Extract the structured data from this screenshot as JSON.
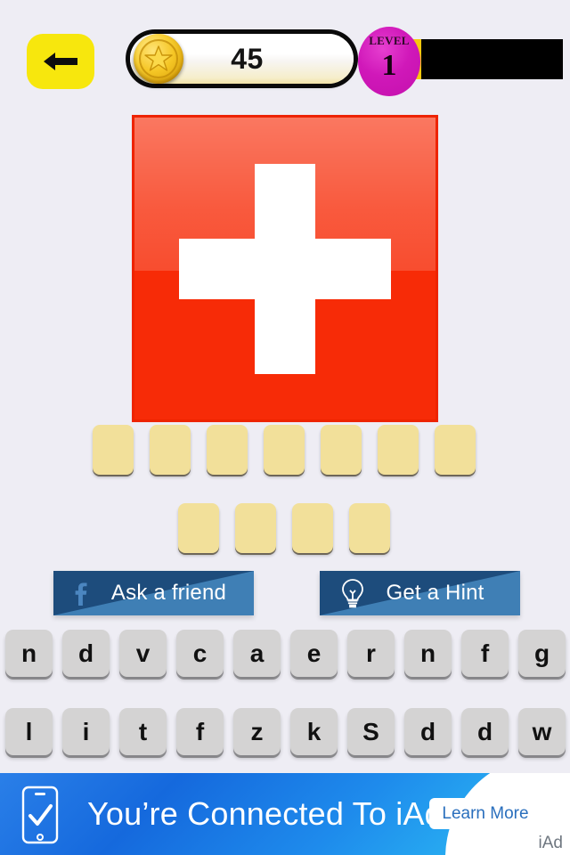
{
  "topbar": {
    "back_icon": "arrow-left-icon",
    "coin_icon": "gold-coin-star-icon",
    "coin_count": "45",
    "level_word": "LEVEL",
    "level_number": "1",
    "progress_percent": 17,
    "progress_fill_color": "#f7c80c",
    "progress_track_color": "#000000",
    "badge_color": "#d018b9",
    "back_button_color": "#f7e70d"
  },
  "flag": {
    "name": "swiss-flag",
    "background_color": "#f72b07",
    "cross_color": "#ffffff",
    "border_color": "#ee2400"
  },
  "answer": {
    "row1": [
      "",
      "",
      "",
      "",
      "",
      "",
      ""
    ],
    "row2": [
      "",
      "",
      "",
      ""
    ],
    "tile_color": "#f2e09a"
  },
  "actions": [
    {
      "name": "ask-friend",
      "label": "Ask a friend",
      "icon": "facebook-f-icon"
    },
    {
      "name": "get-hint",
      "label": "Get a Hint",
      "icon": "lightbulb-icon"
    }
  ],
  "keyboard": {
    "row1": [
      "n",
      "d",
      "v",
      "c",
      "a",
      "e",
      "r",
      "n",
      "f",
      "g"
    ],
    "row2": [
      "l",
      "i",
      "t",
      "f",
      "z",
      "k",
      "S",
      "d",
      "d",
      "w"
    ],
    "key_color": "#d4d3d3"
  },
  "ad": {
    "headline": "You’re Connected To iAd",
    "cta_label": "Learn More",
    "mark": "iAd",
    "phone_icon": "phone-checkmark-icon"
  }
}
